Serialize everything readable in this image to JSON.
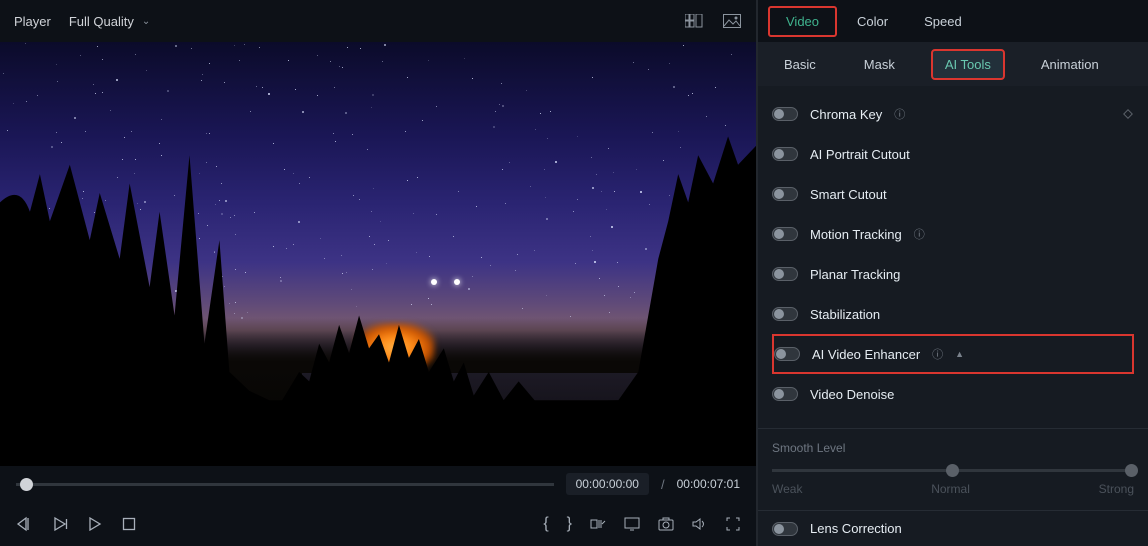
{
  "top_bar": {
    "player_label": "Player",
    "quality_label": "Full Quality"
  },
  "timeline": {
    "current": "00:00:00:00",
    "separator": "/",
    "duration": "00:00:07:01"
  },
  "main_tabs": {
    "video": "Video",
    "color": "Color",
    "speed": "Speed"
  },
  "sub_tabs": {
    "basic": "Basic",
    "mask": "Mask",
    "ai_tools": "AI Tools",
    "animation": "Animation"
  },
  "tools": {
    "chroma_key": "Chroma Key",
    "ai_portrait_cutout": "AI Portrait Cutout",
    "smart_cutout": "Smart Cutout",
    "motion_tracking": "Motion Tracking",
    "planar_tracking": "Planar Tracking",
    "stabilization": "Stabilization",
    "ai_video_enhancer": "AI Video Enhancer",
    "video_denoise": "Video Denoise",
    "lens_correction": "Lens Correction"
  },
  "smooth": {
    "title": "Smooth Level",
    "weak": "Weak",
    "normal": "Normal",
    "strong": "Strong"
  }
}
